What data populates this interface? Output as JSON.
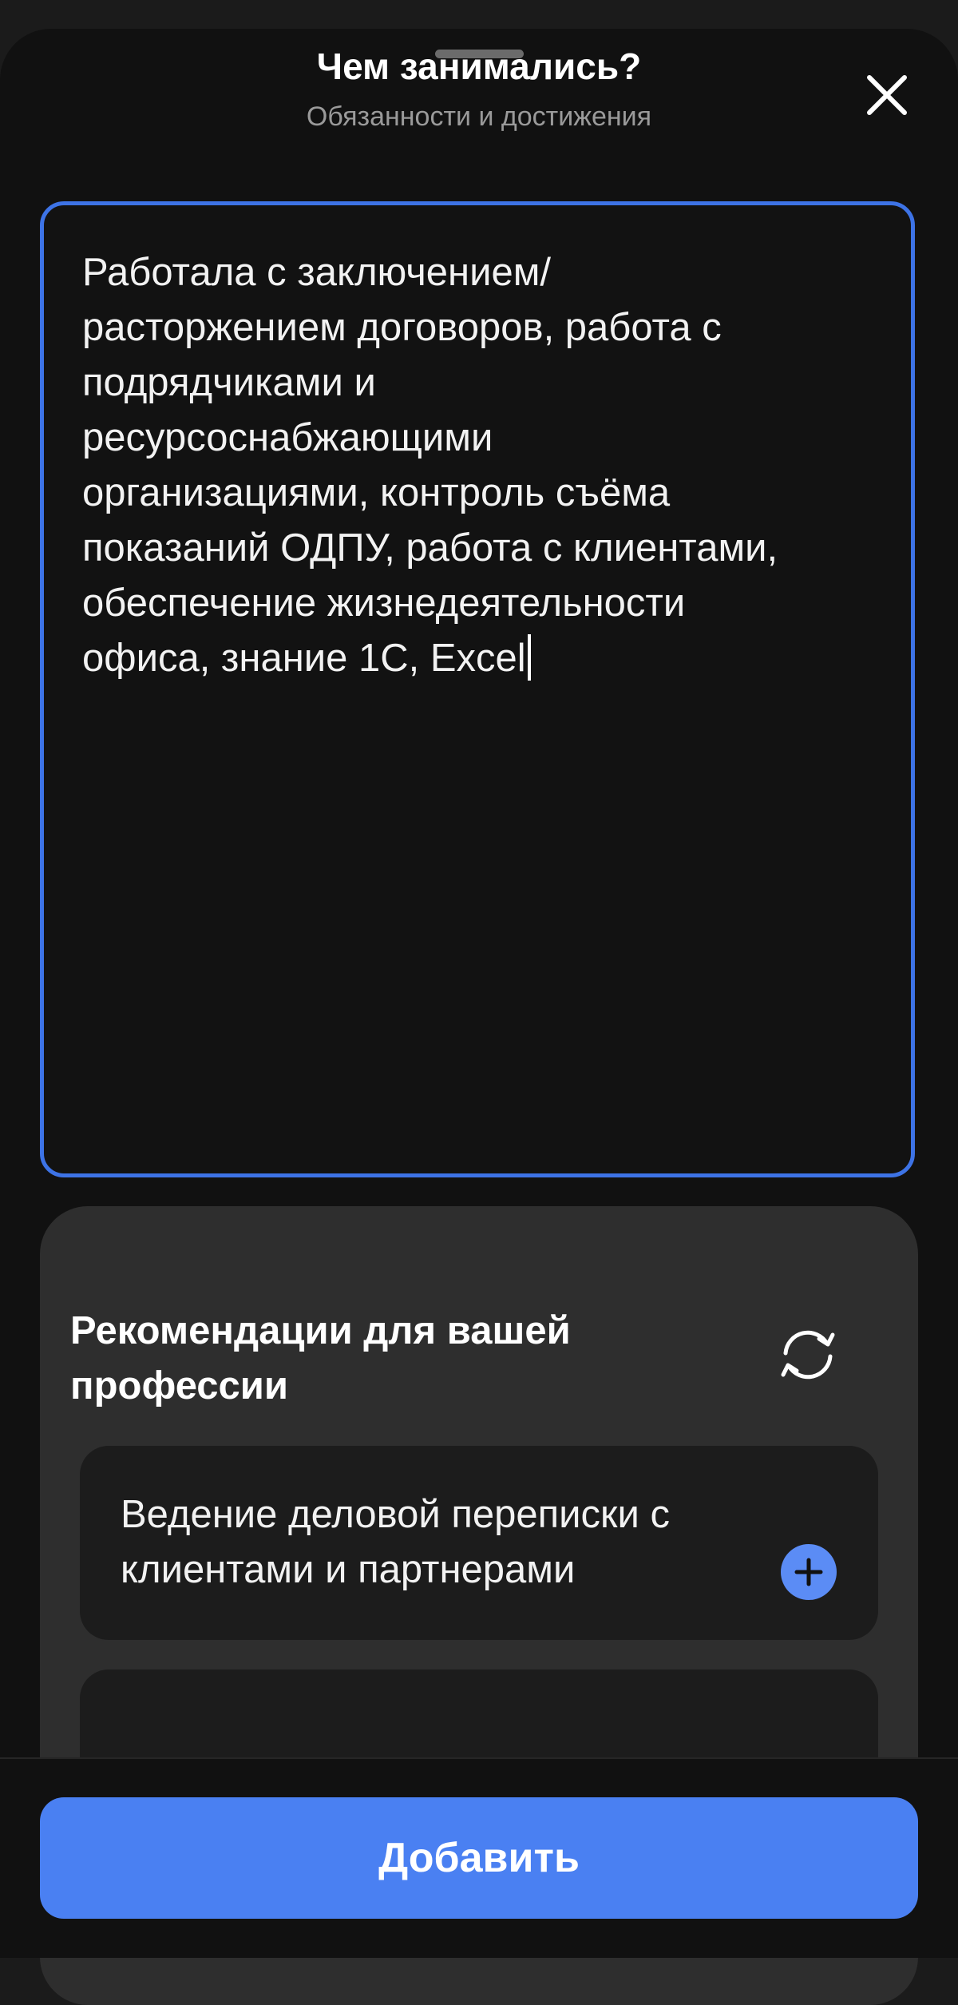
{
  "header": {
    "title": "Чем занимались?",
    "subtitle": "Обязанности и достижения",
    "close_icon": "close-icon"
  },
  "editor": {
    "value": "Работала с заключением/\nрасторжением договоров, работа с\nподрядчиками и\nресурсоснабжающими\nорганизациями, контроль съёма\nпоказаний ОДПУ, работа с клиентами,\nобеспечение жизнедеятельности\nофиса, знание 1С, Excel",
    "focus_color": "#3d73e6"
  },
  "recommendations": {
    "title": "Рекомендации для вашей профессии",
    "refresh_icon": "refresh-icon",
    "items": [
      {
        "label": "Ведение деловой переписки с клиентами и партнерами",
        "action_icon": "plus-icon"
      }
    ]
  },
  "footer": {
    "add_label": "Добавить",
    "accent_color": "#4a80f2"
  }
}
